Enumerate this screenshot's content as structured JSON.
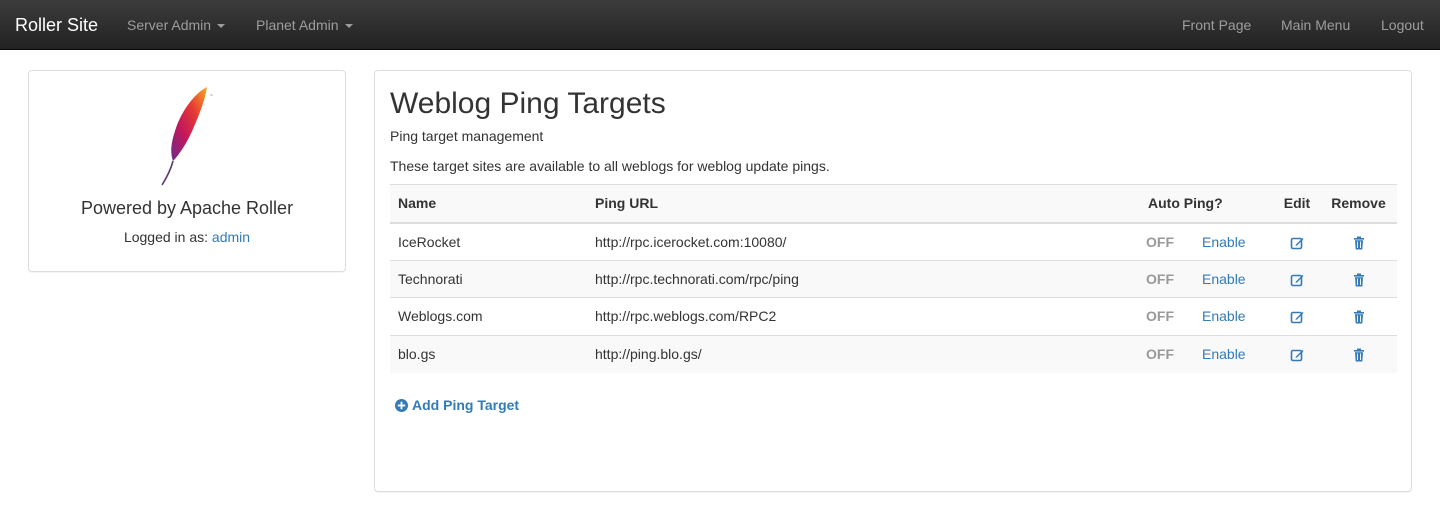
{
  "navbar": {
    "brand": "Roller Site",
    "left_menus": [
      {
        "label": "Server Admin"
      },
      {
        "label": "Planet Admin"
      }
    ],
    "right_links": [
      {
        "label": "Front Page"
      },
      {
        "label": "Main Menu"
      },
      {
        "label": "Logout"
      }
    ]
  },
  "sidebar": {
    "logo_icon": "apache-feather-logo",
    "powered_by": "Powered by Apache Roller",
    "logged_in_label": "Logged in as:",
    "username": "admin"
  },
  "main": {
    "title": "Weblog Ping Targets",
    "subtitle": "Ping target management",
    "description": "These target sites are available to all weblogs for weblog update pings.",
    "table": {
      "headers": {
        "name": "Name",
        "url": "Ping URL",
        "auto": "Auto Ping?",
        "edit": "Edit",
        "remove": "Remove"
      },
      "rows": [
        {
          "name": "IceRocket",
          "url": "http://rpc.icerocket.com:10080/",
          "status": "OFF",
          "action": "Enable"
        },
        {
          "name": "Technorati",
          "url": "http://rpc.technorati.com/rpc/ping",
          "status": "OFF",
          "action": "Enable"
        },
        {
          "name": "Weblogs.com",
          "url": "http://rpc.weblogs.com/RPC2",
          "status": "OFF",
          "action": "Enable"
        },
        {
          "name": "blo.gs",
          "url": "http://ping.blo.gs/",
          "status": "OFF",
          "action": "Enable"
        }
      ]
    },
    "add_button": "Add Ping Target"
  },
  "colors": {
    "link": "#337ab7",
    "navbar_bg": "#222222",
    "off_text": "#999999"
  }
}
